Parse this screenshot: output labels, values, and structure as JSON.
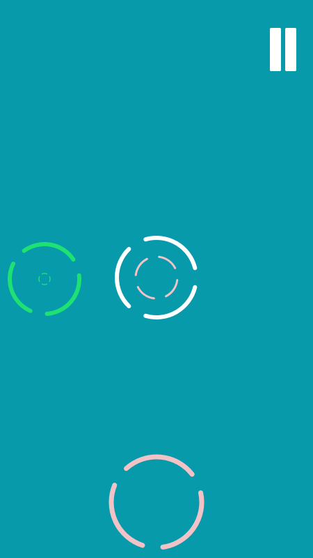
{
  "screen": {
    "background": "#069aab"
  },
  "pause": {
    "icon": "pause-icon",
    "color": "#ffffff"
  },
  "rings": [
    {
      "name": "green-ring-outer",
      "color": "#1fe073",
      "gaps": 3,
      "rotation_deg": 100
    },
    {
      "name": "green-ring-core",
      "color": "#1fe073",
      "gaps": 4,
      "rotation_deg": 45
    },
    {
      "name": "white-ring-outer",
      "color": "#ffffff",
      "gaps": 3,
      "rotation_deg": 120
    },
    {
      "name": "pink-ring-inner",
      "color": "#f1c3c7",
      "gaps": 4,
      "rotation_deg": 80
    },
    {
      "name": "pink-ring-bottom",
      "color": "#f1c3c7",
      "gaps": 3,
      "rotation_deg": 95
    }
  ]
}
